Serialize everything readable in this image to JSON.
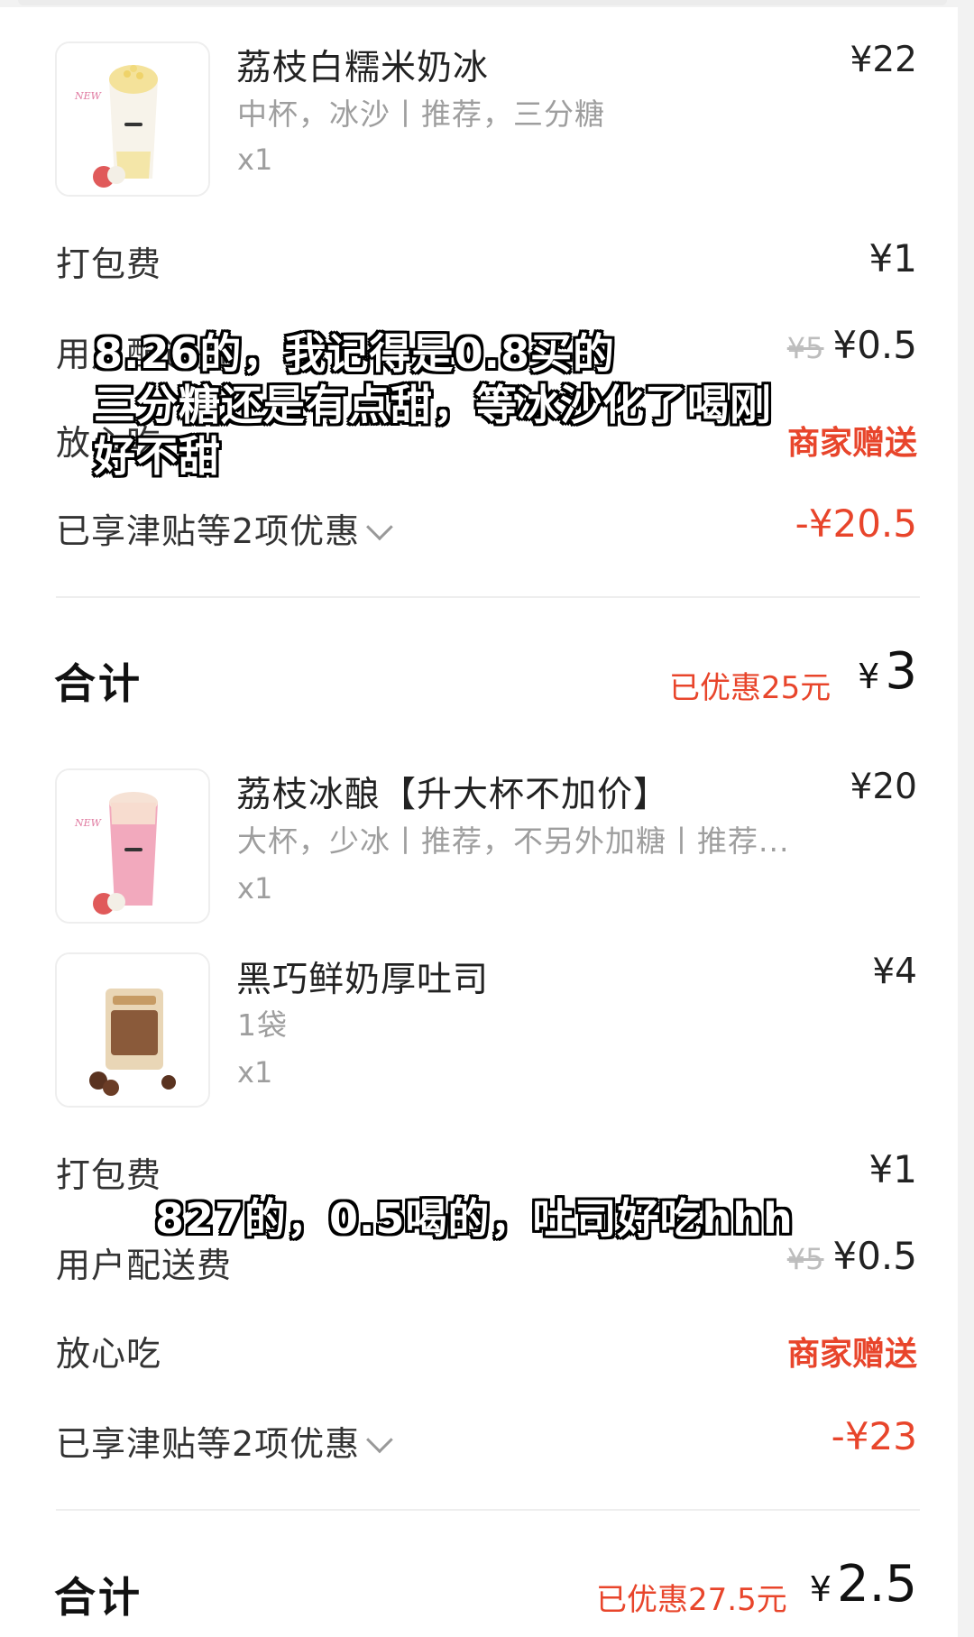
{
  "order1": {
    "item": {
      "name": "荔枝白糯米奶冰",
      "spec": "中杯，冰沙丨推荐，三分糖",
      "qty": "x1",
      "price": "¥22",
      "image": "lychee-milk-ice-drink"
    },
    "packing_fee": {
      "label": "打包费",
      "value": "¥1"
    },
    "delivery_fee": {
      "label": "用户配送费",
      "original": "¥5",
      "value": "¥0.5"
    },
    "assurance": {
      "label": "放心吃",
      "value": "商家赠送"
    },
    "discounts": {
      "label": "已享津贴等2项优惠",
      "value": "-¥20.5"
    },
    "total": {
      "label": "合计",
      "saved": "已优惠25元",
      "yen": "¥",
      "amount": "3"
    }
  },
  "order2": {
    "items": [
      {
        "name": "荔枝冰酿【升大杯不加价】",
        "spec": "大杯，少冰丨推荐，不另外加糖丨推荐...",
        "qty": "x1",
        "price": "¥20",
        "image": "lychee-pink-drink"
      },
      {
        "name": "黑巧鲜奶厚吐司",
        "spec": "1袋",
        "qty": "x1",
        "price": "¥4",
        "image": "chocolate-toast-bag"
      }
    ],
    "packing_fee": {
      "label": "打包费",
      "value": "¥1"
    },
    "delivery_fee": {
      "label": "用户配送费",
      "original": "¥5",
      "value": "¥0.5"
    },
    "assurance": {
      "label": "放心吃",
      "value": "商家赠送"
    },
    "discounts": {
      "label": "已享津贴等2项优惠",
      "value": "-¥23"
    },
    "total": {
      "label": "合计",
      "saved": "已优惠27.5元",
      "yen": "¥",
      "amount": "2.5"
    }
  },
  "captions": {
    "c1_line1": "8.26的，我记得是0.8买的",
    "c1_line2": "三分糖还是有点甜，等冰沙化了喝刚",
    "c1_line3": "好不甜",
    "c2": "827的，0.5喝的，吐司好吃hhh"
  },
  "colors": {
    "accent": "#e8452b",
    "text": "#222222",
    "muted": "#9e9e9e"
  }
}
